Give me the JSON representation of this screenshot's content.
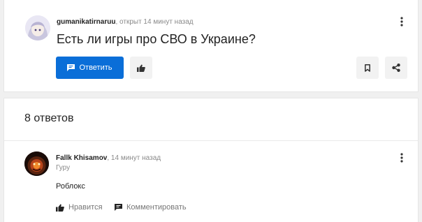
{
  "question": {
    "author": "gumanikatirnaruu",
    "meta": ", открыт 14 минут назад",
    "title": "Есть ли игры про СВО в Украине?",
    "answer_button_label": "Ответить",
    "icons": {
      "answer": "comment-icon",
      "like": "thumbs-up-icon",
      "bookmark": "bookmark-icon",
      "share": "share-icon",
      "menu": "more-vertical-icon"
    }
  },
  "answers": {
    "count_label": "8 ответов",
    "items": [
      {
        "author": "Fallk Khisamov",
        "meta": ", 14 минут назад",
        "role": "Гуру",
        "text": "Роблокс",
        "like_label": "Нравится",
        "comment_label": "Комментировать"
      }
    ]
  },
  "colors": {
    "accent": "#0a6ed8",
    "background": "#f0f0f0",
    "card": "#ffffff",
    "muted": "#8a8a8a"
  }
}
